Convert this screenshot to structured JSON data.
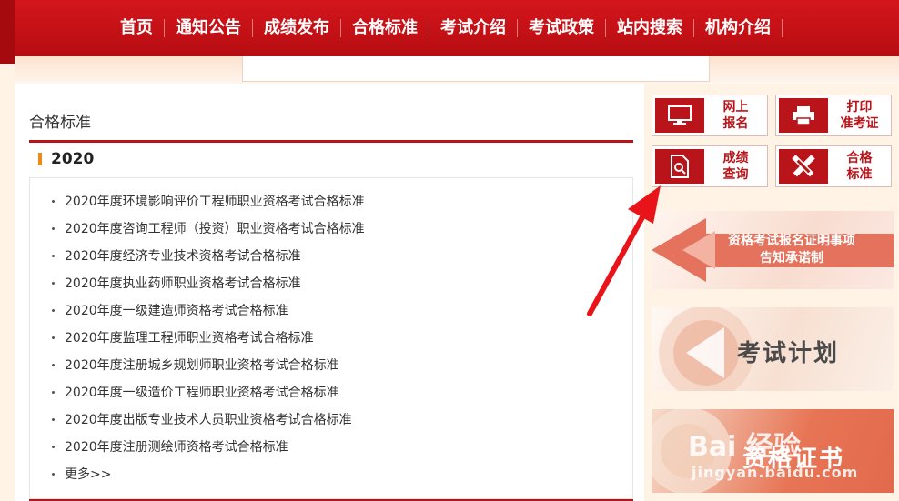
{
  "nav": {
    "items": [
      "首页",
      "通知公告",
      "成绩发布",
      "合格标准",
      "考试介绍",
      "考试政策",
      "站内搜索",
      "机构介绍"
    ]
  },
  "main": {
    "section_title": "合格标准",
    "year": "2020",
    "items": [
      "2020年度环境影响评价工程师职业资格考试合格标准",
      "2020年度咨询工程师（投资）职业资格考试合格标准",
      "2020年度经济专业技术资格考试合格标准",
      "2020年度执业药师职业资格考试合格标准",
      "2020年度一级建造师资格考试合格标准",
      "2020年度监理工程师职业资格考试合格标准",
      "2020年度注册城乡规划师职业资格考试合格标准",
      "2020年度一级造价工程师职业资格考试合格标准",
      "2020年度出版专业技术人员职业资格考试合格标准",
      "2020年度注册测绘师资格考试合格标准"
    ],
    "more": "更多>>"
  },
  "sidebar": {
    "buttons": [
      {
        "label": "网上\n报名",
        "icon": "monitor-icon"
      },
      {
        "label": "打印\n准考证",
        "icon": "printer-icon"
      },
      {
        "label": "成绩\n查询",
        "icon": "document-search-icon"
      },
      {
        "label": "合格\n标准",
        "icon": "pencil-ruler-icon"
      }
    ],
    "banners": [
      {
        "line1": "资格考试报名证明事项",
        "line2": "告知承诺制"
      },
      {
        "text": "考试计划"
      },
      {
        "text": "资格证书"
      }
    ]
  },
  "watermark": {
    "logo": "Bai 经验",
    "url": "jingyan.baidu.com"
  },
  "colors": {
    "primary": "#b8141a",
    "accent": "#e98a1a",
    "arrow": "#e8141a"
  }
}
